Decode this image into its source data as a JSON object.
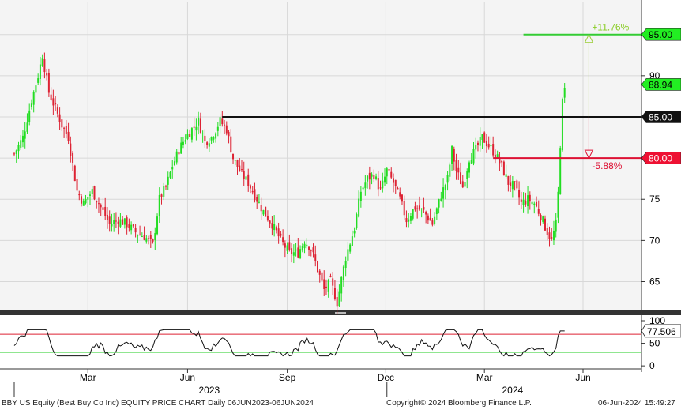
{
  "chart_data": [
    {
      "type": "candlestick",
      "ticker": "BBY US Equity (Best Buy Co Inc) EQUITY PRICE CHART",
      "ylim": [
        61.5,
        99
      ],
      "yticks": [
        65,
        70,
        75,
        80,
        85,
        90,
        95
      ],
      "grid": true,
      "colors": {
        "up": "#22dd22",
        "down": "#dd2233",
        "grid": "#d8d8d8",
        "background": "#f4f4f4"
      },
      "x_month_labels": [
        {
          "label": "Mar",
          "x": 68
        },
        {
          "label": "Jun",
          "x": 160
        },
        {
          "label": "Sep",
          "x": 252
        },
        {
          "label": "Dec",
          "x": 343
        },
        {
          "label": "Mar",
          "x": 434
        },
        {
          "label": "Jun",
          "x": 525
        }
      ],
      "x_year_labels": [
        {
          "label": "2023",
          "x": 180
        },
        {
          "label": "2024",
          "x": 460
        }
      ],
      "x_range": [
        0,
        560
      ],
      "close_path": [
        [
          0,
          80.5
        ],
        [
          8,
          82.5
        ],
        [
          16,
          87.0
        ],
        [
          22,
          90.0
        ],
        [
          26,
          92.5
        ],
        [
          32,
          88.0
        ],
        [
          38,
          86.0
        ],
        [
          44,
          84.0
        ],
        [
          50,
          82.5
        ],
        [
          58,
          76.0
        ],
        [
          64,
          74.5
        ],
        [
          72,
          76.0
        ],
        [
          80,
          74.0
        ],
        [
          88,
          72.0
        ],
        [
          96,
          72.5
        ],
        [
          104,
          72.0
        ],
        [
          112,
          71.0
        ],
        [
          120,
          70.5
        ],
        [
          128,
          69.5
        ],
        [
          134,
          75.0
        ],
        [
          140,
          76.5
        ],
        [
          146,
          79.0
        ],
        [
          152,
          81.0
        ],
        [
          158,
          82.5
        ],
        [
          164,
          83.5
        ],
        [
          170,
          84.5
        ],
        [
          176,
          82.0
        ],
        [
          182,
          82.5
        ],
        [
          190,
          84.5
        ],
        [
          196,
          83.5
        ],
        [
          202,
          80.0
        ],
        [
          210,
          78.0
        ],
        [
          216,
          77.0
        ],
        [
          222,
          75.5
        ],
        [
          230,
          73.5
        ],
        [
          238,
          72.0
        ],
        [
          246,
          70.0
        ],
        [
          254,
          68.5
        ],
        [
          262,
          68.5
        ],
        [
          268,
          70.0
        ],
        [
          274,
          69.0
        ],
        [
          280,
          66.5
        ],
        [
          286,
          64.0
        ],
        [
          292,
          65.0
        ],
        [
          298,
          62.5
        ],
        [
          306,
          68.0
        ],
        [
          314,
          71.5
        ],
        [
          320,
          76.0
        ],
        [
          326,
          77.5
        ],
        [
          332,
          78.0
        ],
        [
          338,
          76.0
        ],
        [
          344,
          78.5
        ],
        [
          350,
          77.0
        ],
        [
          356,
          75.0
        ],
        [
          362,
          72.5
        ],
        [
          370,
          74.0
        ],
        [
          378,
          73.5
        ],
        [
          386,
          72.0
        ],
        [
          394,
          75.5
        ],
        [
          400,
          77.5
        ],
        [
          404,
          81.0
        ],
        [
          408,
          78.5
        ],
        [
          414,
          76.5
        ],
        [
          420,
          80.0
        ],
        [
          426,
          81.0
        ],
        [
          432,
          82.5
        ],
        [
          438,
          81.5
        ],
        [
          444,
          80.5
        ],
        [
          450,
          79.0
        ],
        [
          456,
          77.0
        ],
        [
          462,
          76.5
        ],
        [
          468,
          74.5
        ],
        [
          474,
          75.0
        ],
        [
          480,
          74.5
        ],
        [
          486,
          73.0
        ],
        [
          492,
          71.0
        ],
        [
          496,
          70.0
        ],
        [
          500,
          72.0
        ],
        [
          503,
          77.5
        ],
        [
          505,
          86.0
        ],
        [
          507,
          87.5
        ],
        [
          509,
          88.9
        ]
      ],
      "lines": [
        {
          "name": "upper-level",
          "value": 95.0,
          "label": "95.00",
          "color": "#33cc33"
        },
        {
          "name": "resistance",
          "value": 85.0,
          "label": "85.00",
          "color": "#111111"
        },
        {
          "name": "support",
          "value": 80.0,
          "label": "80.00",
          "color": "#dd1133"
        }
      ],
      "last_price": {
        "value": 88.94,
        "label": "88.94",
        "color": "#33cc33"
      },
      "annotations": [
        {
          "text": "+11.76%",
          "color": "#88cc22",
          "value": 95.0
        },
        {
          "text": "-5.88%",
          "color": "#dd1133",
          "value": 80.0
        }
      ]
    },
    {
      "type": "line",
      "name": "RSI",
      "ylim": [
        -5,
        107
      ],
      "yticks": [
        0,
        50,
        100
      ],
      "ytick_labels": [
        "0",
        "50",
        "100"
      ],
      "levels": [
        {
          "value": 70,
          "color": "#dd2233"
        },
        {
          "value": 30,
          "color": "#22cc22"
        }
      ],
      "last_value": {
        "value": 77.506,
        "label": "77.506"
      }
    }
  ],
  "footer": {
    "left": "BBY US Equity (Best Buy Co Inc) EQUITY PRICE CHART  Daily 06JUN2023-06JUN2024",
    "center": "Copyright© 2024 Bloomberg Finance L.P.",
    "right": "06-Jun-2024 15:49:27"
  }
}
